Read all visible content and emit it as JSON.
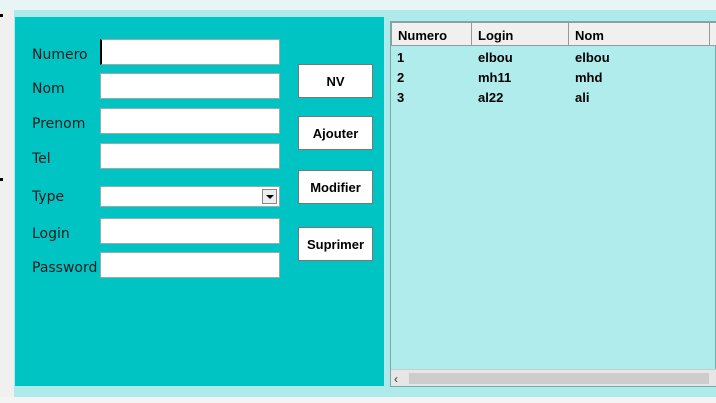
{
  "form": {
    "fields": [
      {
        "label": "Numero",
        "value": ""
      },
      {
        "label": "Nom",
        "value": ""
      },
      {
        "label": "Prenom",
        "value": ""
      },
      {
        "label": "Tel",
        "value": ""
      },
      {
        "label": "Type",
        "value": ""
      },
      {
        "label": "Login",
        "value": ""
      },
      {
        "label": "Password",
        "value": ""
      }
    ]
  },
  "buttons": {
    "nv": "NV",
    "ajouter": "Ajouter",
    "modifier": "Modifier",
    "suprimer": "Suprimer"
  },
  "table": {
    "columns": [
      "Numero",
      "Login",
      "Nom",
      ""
    ],
    "rows": [
      [
        "1",
        "elbou",
        "elbou"
      ],
      [
        "2",
        "mh11",
        "mhd"
      ],
      [
        "3",
        "al22",
        "ali"
      ]
    ]
  },
  "colors": {
    "panel": "#00c4c4",
    "table_bg": "#b0ecec"
  },
  "icons": {
    "select_arrow": "chevron-down-icon",
    "scroll_left": "chevron-left-icon"
  }
}
